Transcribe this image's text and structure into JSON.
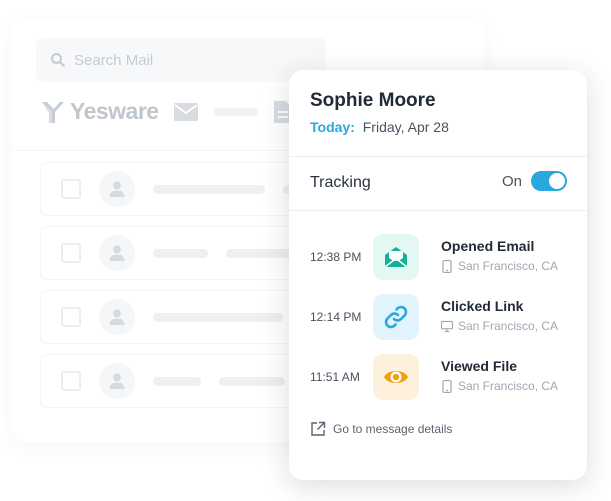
{
  "background_window": {
    "search_placeholder": "Search Mail",
    "logo_text": "Yesware",
    "rows": [
      {},
      {},
      {},
      {}
    ]
  },
  "card": {
    "contact_name": "Sophie Moore",
    "date_prefix": "Today:",
    "date_value": "Friday, Apr 28",
    "tracking_label": "Tracking",
    "toggle_state_label": "On",
    "toggle_on": true,
    "events": [
      {
        "time": "12:38 PM",
        "title": "Opened Email",
        "location": "San Francisco, CA",
        "device": "mobile",
        "icon": "envelope-open-icon",
        "color": "#0fb39a",
        "bg": "#e3f7f3"
      },
      {
        "time": "12:14 PM",
        "title": "Clicked Link",
        "location": "San Francisco, CA",
        "device": "desktop",
        "icon": "link-icon",
        "color": "#2aa7dd",
        "bg": "#e3f3fb"
      },
      {
        "time": "11:51 AM",
        "title": "Viewed File",
        "location": "San Francisco, CA",
        "device": "mobile",
        "icon": "eye-icon",
        "color": "#f59e0b",
        "bg": "#fdf0dc"
      }
    ],
    "details_link": "Go to message details"
  },
  "colors": {
    "accent": "#2aa7dd",
    "opened": "#0fb39a",
    "clicked": "#2aa7dd",
    "viewed": "#f59e0b"
  }
}
